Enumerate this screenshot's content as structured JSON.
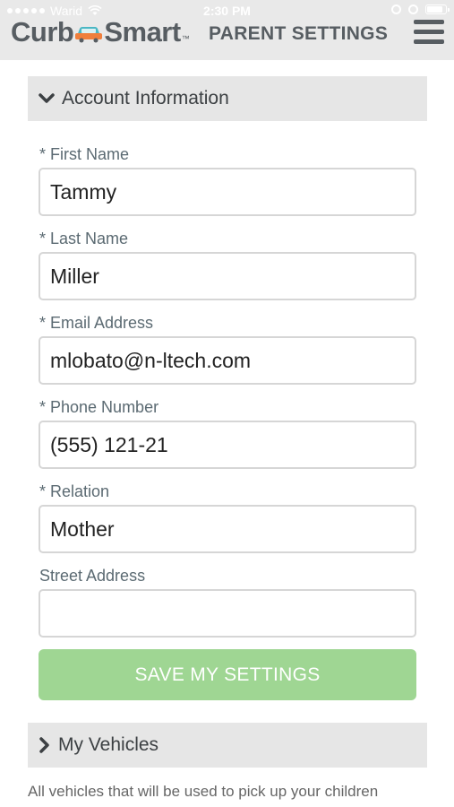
{
  "status_bar": {
    "carrier": "Warid",
    "time": "2:30 PM",
    "battery_level": 0.85
  },
  "header": {
    "logo_part1": "Curb",
    "logo_part2": "Smart",
    "logo_tm": "™",
    "title": "PARENT SETTINGS",
    "menu_icon": "hamburger-menu-icon"
  },
  "account_section": {
    "title": "Account Information",
    "expanded": true,
    "fields": [
      {
        "label": "* First Name",
        "value": "Tammy"
      },
      {
        "label": "* Last Name",
        "value": "Miller"
      },
      {
        "label": "* Email Address",
        "value": "mlobato@n-ltech.com"
      },
      {
        "label": "* Phone Number",
        "value": "(555) 121-21"
      },
      {
        "label": "* Relation",
        "value": "Mother"
      },
      {
        "label": "Street Address",
        "value": ""
      }
    ],
    "save_label": "SAVE MY SETTINGS"
  },
  "vehicles_section": {
    "title": "My Vehicles",
    "expanded": false,
    "description": "All vehicles that will be used to pick up your children"
  },
  "colors": {
    "header_bg": "#e9e9e9",
    "section_bg": "#e6e6e6",
    "save_button": "#9fd693",
    "logo_text": "#575d62",
    "logo_car_orange": "#f07f3c",
    "logo_car_teal": "#4bb7c4"
  }
}
